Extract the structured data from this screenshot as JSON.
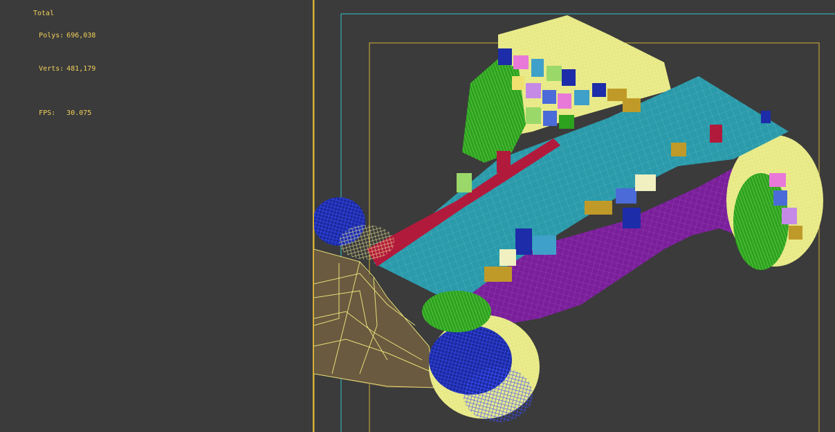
{
  "colors": {
    "background": "#3b3b3b",
    "stats_text": "#f2d15b",
    "viewport_frame": "#d4b037",
    "safe_frame": "#36c0c9",
    "terrain_brown": "#6a5a3f",
    "terrain_lines": "#e8e07a",
    "deck_teal": "#2b9aaa",
    "deck_lines": "#66cfe0",
    "cliff_purple": "#7a1f9a",
    "cliff_lines": "#a64cc6",
    "foliage_green": "#2da21f",
    "foliage_yellow": "#e6e885",
    "rock_blue": "#1a2a9c",
    "crimson": "#b21a3c",
    "gold": "#c09a28"
  },
  "stats": {
    "title": "Total",
    "polys_label": "Polys:",
    "polys_value": "696,038",
    "verts_label": "Verts:",
    "verts_value": "481,179",
    "fps_label": "FPS:",
    "fps_value": "30.075"
  },
  "viewport": {
    "icons": {
      "mesh": "wireframe-mesh-icon"
    }
  }
}
